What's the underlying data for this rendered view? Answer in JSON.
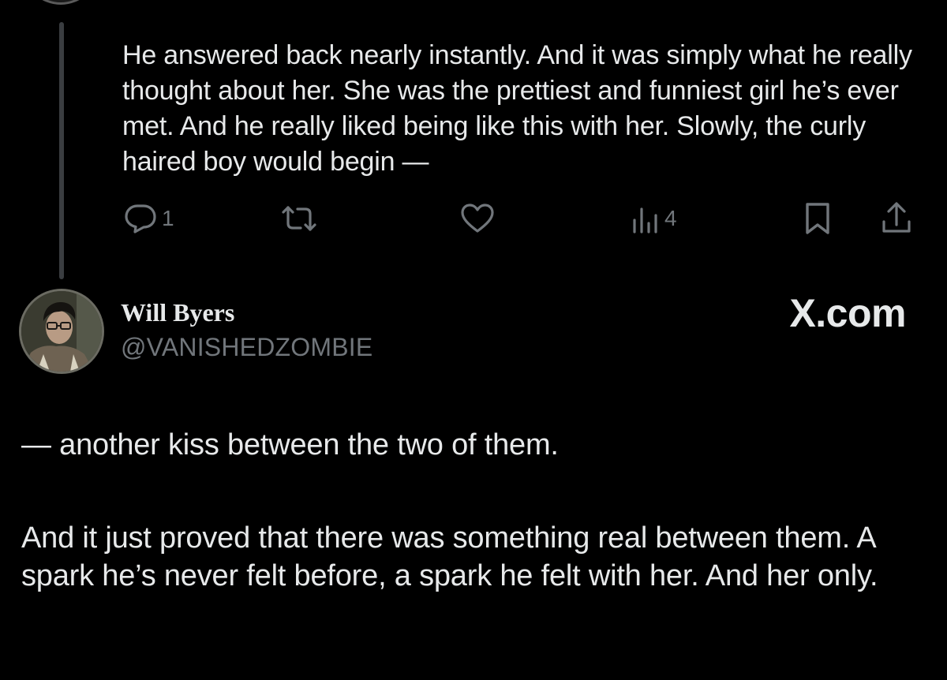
{
  "previous_tweet": {
    "text": "He answered back nearly instantly. And it was simply what he really thought about her. She was the prettiest and funniest girl he’s ever met. And he really liked being like this with her. Slowly, the curly haired boy would begin —",
    "actions": {
      "reply_count": "1",
      "views_count": "4"
    }
  },
  "current_tweet": {
    "author": {
      "name": "Will Byers",
      "handle": "@VANISHEDZOMBIE"
    },
    "paragraphs": [
      "— another kiss between the two of them.",
      "And it just proved that there was something real between them. A spark he’s never felt before, a spark he felt with her. And her only."
    ]
  },
  "watermark": "X.com",
  "icons": {
    "reply": "reply-icon",
    "retweet": "retweet-icon",
    "like": "heart-icon",
    "views": "views-icon",
    "bookmark": "bookmark-icon",
    "share": "share-icon"
  },
  "colors": {
    "background": "#000000",
    "text": "#e7e9ea",
    "secondary_text": "#71767b",
    "thread_line": "#3a3d40"
  }
}
